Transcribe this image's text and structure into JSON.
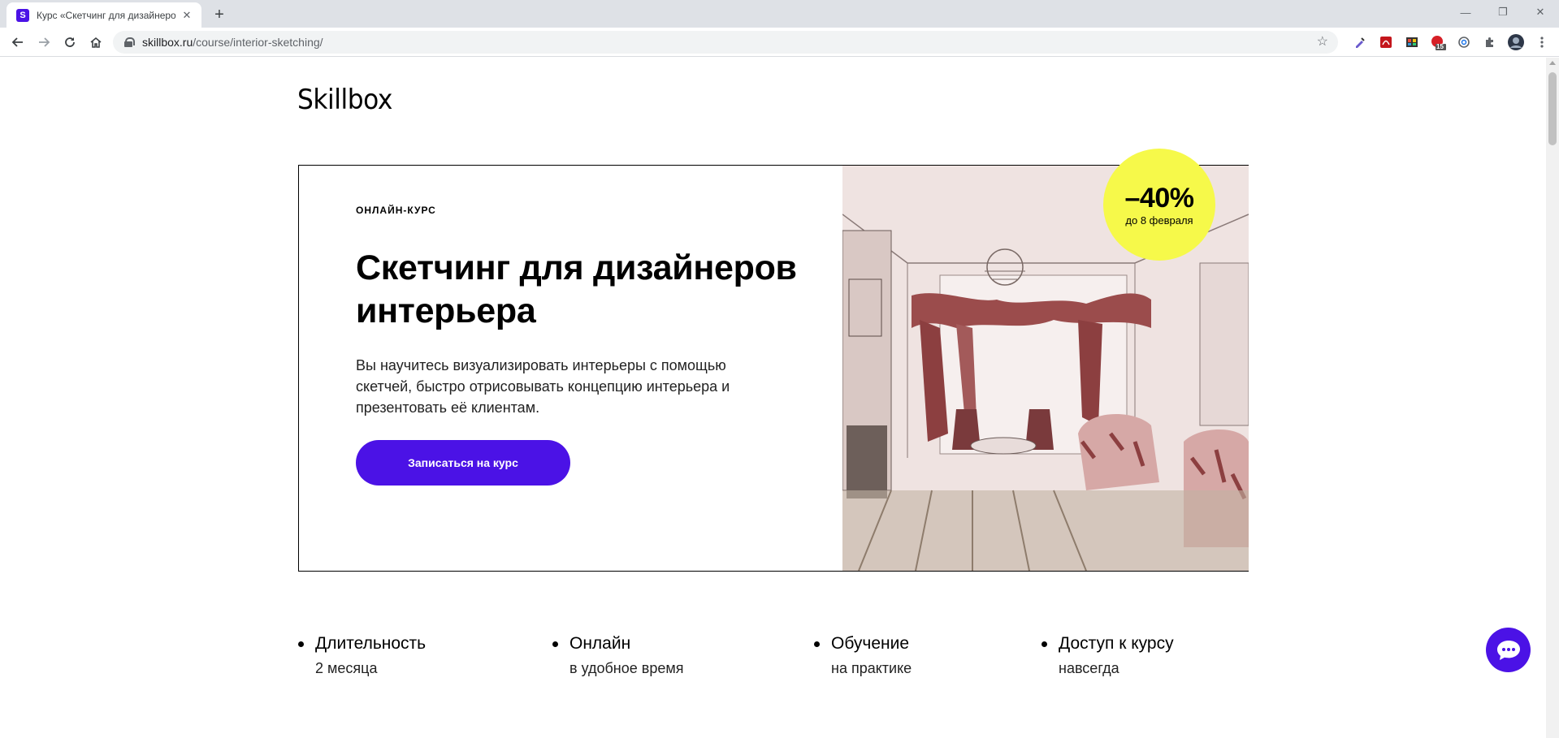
{
  "browser": {
    "tab_title": "Курс «Скетчинг для дизайнеров интерьера»",
    "tab_favicon": "S",
    "url_host": "skillbox.ru",
    "url_path": "/course/interior-sketching/",
    "extension_badge": "15"
  },
  "page": {
    "logo": "Skillbox",
    "hero": {
      "eyebrow": "ОНЛАЙН-КУРС",
      "title": "Скетчинг для дизайнеров интерьера",
      "description": "Вы научитесь визуализировать интерьеры с помощью скетчей, быстро отрисовывать концепцию интерьера и презентовать её клиентам.",
      "cta_label": "Записаться на курс"
    },
    "badge": {
      "discount": "–40%",
      "until": "до 8 февраля"
    },
    "features": [
      {
        "title": "Длительность",
        "subtitle": "2 месяца"
      },
      {
        "title": "Онлайн",
        "subtitle": "в удобное время"
      },
      {
        "title": "Обучение",
        "subtitle": "на практике"
      },
      {
        "title": "Доступ к курсу",
        "subtitle": "навсегда"
      }
    ]
  },
  "colors": {
    "brand": "#4b12e6",
    "badge": "#f6f94a"
  }
}
